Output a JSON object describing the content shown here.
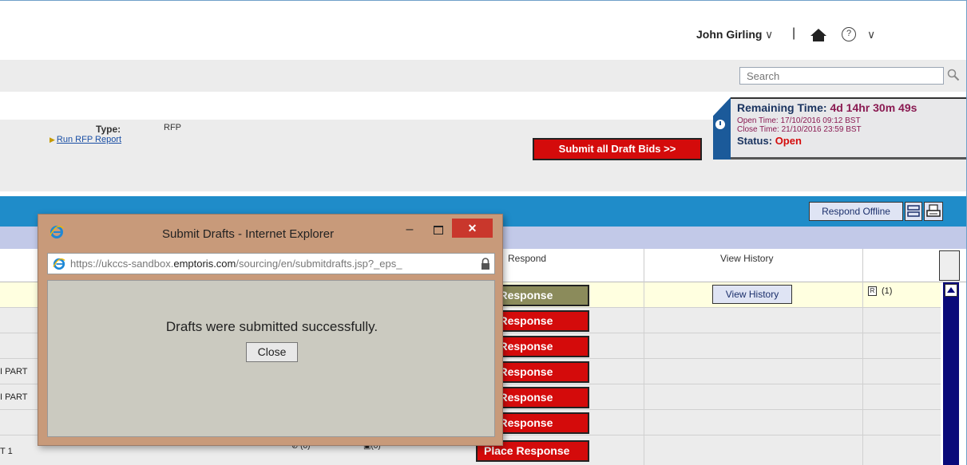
{
  "user": {
    "name": "John Girling",
    "name_chevron": "∨",
    "separator": "|",
    "help_glyph": "?",
    "help_chevron": "∨"
  },
  "search": {
    "placeholder": "Search"
  },
  "info": {
    "type_label": "Type:",
    "type_value": "RFP",
    "report_link": "Run RFP Report",
    "submit_all_label": "Submit all Draft Bids >>"
  },
  "timer": {
    "remaining_label": "Remaining Time:",
    "remaining_value": "4d 14hr 30m 49s",
    "open_time": "Open Time: 17/10/2016 09:12 BST",
    "close_time": "Close Time: 21/10/2016 23:59 BST",
    "status_label": "Status:",
    "status_value": "Open"
  },
  "toolbar": {
    "respond_offline": "Respond Offline"
  },
  "columns": {
    "respond": "Respond",
    "view_history": "View History"
  },
  "rows": [
    {
      "label": "",
      "action": "se Response",
      "view_history": "View History",
      "doc_count": "(1)"
    },
    {
      "label": "",
      "action": "ce Response"
    },
    {
      "label": "",
      "action": "ce Response"
    },
    {
      "label": "I PART",
      "action": "ce Response"
    },
    {
      "label": "I PART",
      "action": "ce Response"
    },
    {
      "label": "",
      "action": "ce Response"
    },
    {
      "label": "T 1",
      "action": "Place Response",
      "link_count": "(0)",
      "image_count": "(0)"
    }
  ],
  "popup": {
    "title": "Submit Drafts - Internet Explorer",
    "minimize_glyph": "–",
    "close_glyph": "✕",
    "url_prefix": "https://ukccs-sandbox.",
    "url_domain": "emptoris.com",
    "url_path": "/sourcing/en/submitdrafts.jsp?_eps_",
    "message": "Drafts were submitted successfully.",
    "close_label": "Close"
  },
  "colors": {
    "accent_blue": "#1f8cc9",
    "danger_red": "#d40b0b",
    "timer_purple": "#8a1a52",
    "popup_frame": "#c89a7a"
  }
}
